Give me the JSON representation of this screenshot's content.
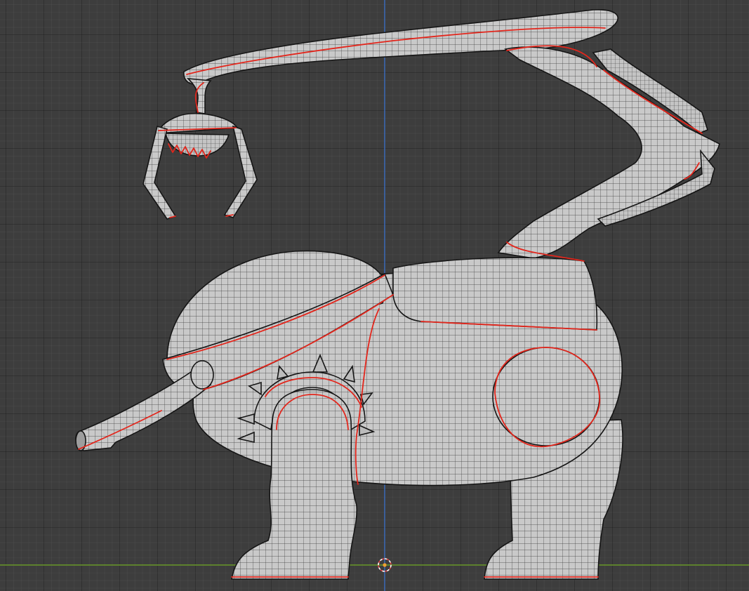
{
  "viewport": {
    "mode": "front-orthographic",
    "colors": {
      "background": "#3d3d3d",
      "x_axis": "#6a9a2a",
      "z_axis": "#3d6fc2",
      "seam": "#e3261c",
      "mesh_fill": "#c9c9c9",
      "wire": "#3a3a3a"
    },
    "icons": [
      "3d-cursor-icon",
      "origin-point-icon"
    ]
  }
}
